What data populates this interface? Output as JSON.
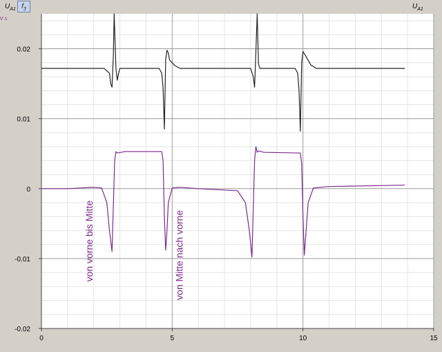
{
  "toolbar": {
    "left_channel": "U",
    "left_channel_sub": "A1",
    "f_button": "f",
    "f_button_sub": "3",
    "right_channel": "U",
    "right_channel_sub": "A1"
  },
  "left_unit_fragment": "V s",
  "colors": {
    "background": "#ffffff",
    "series1": "#222222",
    "series2": "#7a2a8c"
  },
  "chart_data": {
    "type": "line",
    "title": "",
    "xlabel": "",
    "ylabel": "",
    "xlim": [
      0,
      15
    ],
    "ylim": [
      -0.02,
      0.025
    ],
    "x_ticks": [
      0,
      5,
      10,
      15
    ],
    "x_tick_labels": [
      "0",
      "5",
      "10",
      "15"
    ],
    "y_ticks": [
      -0.02,
      -0.01,
      0,
      0.01,
      0.02
    ],
    "y_tick_labels": [
      "-0.02",
      "-0.01",
      "0",
      "0.01",
      "0.02"
    ],
    "grid": true,
    "annotations": [
      {
        "text": "von vorne bis Mitte",
        "x": 1.95,
        "y": -0.0075
      },
      {
        "text": "von Mitte nach vorne",
        "x": 5.4,
        "y": -0.0095
      }
    ],
    "series": [
      {
        "x": [
          0,
          2.4,
          2.6,
          2.65,
          2.7,
          2.75,
          2.78,
          2.85,
          2.9,
          2.95,
          3.0,
          3.2,
          4.5,
          4.6,
          4.65,
          4.7,
          4.75,
          4.8,
          4.85,
          4.9,
          5.1,
          5.3,
          5.6,
          8.0,
          8.1,
          8.15,
          8.2,
          8.25,
          8.3,
          8.35,
          8.4,
          9.7,
          9.8,
          9.85,
          9.9,
          9.95,
          10.0,
          10.1,
          10.3,
          10.5,
          13.9
        ],
        "y": [
          0.0172,
          0.0172,
          0.0165,
          0.015,
          0.0145,
          0.019,
          0.025,
          0.0172,
          0.0155,
          0.0165,
          0.0172,
          0.0172,
          0.0172,
          0.0165,
          0.0145,
          0.0085,
          0.0185,
          0.0198,
          0.0194,
          0.0184,
          0.0176,
          0.0172,
          0.0172,
          0.0172,
          0.016,
          0.0145,
          0.0195,
          0.025,
          0.0178,
          0.0172,
          0.0172,
          0.0172,
          0.0165,
          0.014,
          0.0082,
          0.018,
          0.0196,
          0.019,
          0.0177,
          0.0172,
          0.0172
        ]
      },
      {
        "x": [
          0,
          1.0,
          2.0,
          2.3,
          2.5,
          2.6,
          2.7,
          2.8,
          2.85,
          2.9,
          3.2,
          4.6,
          4.65,
          4.7,
          4.75,
          4.8,
          4.85,
          5.0,
          5.3,
          6.0,
          7.5,
          7.8,
          7.95,
          8.05,
          8.15,
          8.2,
          8.25,
          8.3,
          8.5,
          9.9,
          9.95,
          10.0,
          10.05,
          10.1,
          10.2,
          10.4,
          11.0,
          12.5,
          13.9
        ],
        "y": [
          0,
          0,
          0.0002,
          0.0001,
          -0.002,
          -0.006,
          -0.009,
          0.004,
          0.0053,
          0.0051,
          0.0053,
          0.0053,
          0.004,
          -0.004,
          -0.0088,
          -0.006,
          -0.002,
          0.0001,
          0.0002,
          0,
          -0.0003,
          -0.002,
          -0.006,
          -0.0098,
          0.004,
          0.006,
          0.0052,
          0.0054,
          0.0052,
          0.0051,
          0.0035,
          -0.004,
          -0.0095,
          -0.007,
          -0.002,
          0.0001,
          0.0003,
          0.0004,
          0.0005
        ]
      }
    ]
  }
}
